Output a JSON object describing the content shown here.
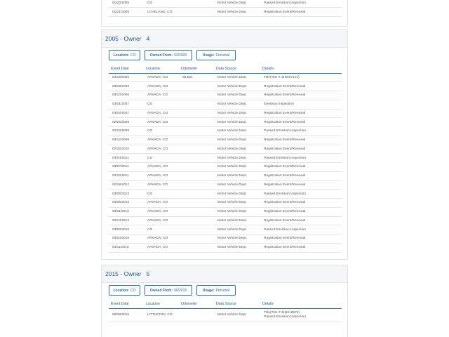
{
  "top_section": {
    "rows": [
      [
        "01/20/2005",
        "CO",
        "",
        "Motor Vehicle Dept.",
        "Passed Emission Inspection"
      ],
      [
        "01/21/2005",
        "LOVELAND, CO",
        "",
        "Motor Vehicle Dept.",
        "Registration Event/Renewal"
      ]
    ]
  },
  "columns": [
    "Event Date",
    "Location",
    "Odometer",
    "Data Source",
    "Details"
  ],
  "owners": [
    {
      "year": "2005",
      "title_sep": " - Owner   ",
      "number": "4",
      "location_label": "Location:",
      "location": "CO",
      "owned_from_label": "Owned From:",
      "owned_from": "03/2005",
      "usage_label": "Usage:",
      "usage": "Personal",
      "rows": [
        [
          "03/18/2005",
          "ARVADA, CO",
          "58,551",
          "Motor Vehicle Dept.",
          "Title(Title #:11R607101)"
        ],
        [
          "03/18/2005",
          "ARVADA, CO",
          "",
          "Motor Vehicle Dept.",
          "Registration Event/Renewal"
        ],
        [
          "03/10/2006",
          "ARVADA, CO",
          "",
          "Motor Vehicle Dept.",
          "Registration Event/Renewal"
        ],
        [
          "03/01/2007",
          "CO",
          "",
          "Motor Vehicle Dept.",
          "Emission Inspection"
        ],
        [
          "03/02/2007",
          "ARVADA, CO",
          "",
          "Motor Vehicle Dept.",
          "Registration Event/Renewal"
        ],
        [
          "02/25/2008",
          "ARVADA, CO",
          "",
          "Motor Vehicle Dept.",
          "Registration Event/Renewal"
        ],
        [
          "03/10/2009",
          "CO",
          "",
          "Motor Vehicle Dept.",
          "Passed Emission Inspection"
        ],
        [
          "03/12/2009",
          "ARVADA, CO",
          "",
          "Motor Vehicle Dept.",
          "Registration Event/Renewal"
        ],
        [
          "02/26/2010",
          "ARVADA, CO",
          "",
          "Motor Vehicle Dept.",
          "Registration Event/Renewal"
        ],
        [
          "03/04/2011",
          "CO",
          "",
          "Motor Vehicle Dept.",
          "Passed Emission Inspection"
        ],
        [
          "03/07/2011",
          "ARVADA, CO",
          "",
          "Motor Vehicle Dept.",
          "Registration Event/Renewal"
        ],
        [
          "03/10/2011",
          "ARVADA, CO",
          "",
          "Motor Vehicle Dept.",
          "Registration Event/Renewal"
        ],
        [
          "02/29/2012",
          "ARVADA, CO",
          "",
          "Motor Vehicle Dept.",
          "Registration Event/Renewal"
        ],
        [
          "03/05/2013",
          "CO",
          "",
          "Motor Vehicle Dept.",
          "Passed Emission Inspection"
        ],
        [
          "03/06/2013",
          "ARVADA, CO",
          "",
          "Motor Vehicle Dept.",
          "Registration Event/Renewal"
        ],
        [
          "03/11/2013",
          "ARVADA, CO",
          "",
          "Motor Vehicle Dept.",
          "Registration Event/Renewal"
        ],
        [
          "03/14/2014",
          "ARVADA, CO",
          "",
          "Motor Vehicle Dept.",
          "Registration Event/Renewal"
        ],
        [
          "03/03/2015",
          "CO",
          "",
          "Motor Vehicle Dept.",
          "Passed Emission Inspection"
        ],
        [
          "03/04/2015",
          "ARVADA, CO",
          "",
          "Motor Vehicle Dept.",
          "Registration Event/Renewal"
        ],
        [
          "03/11/2015",
          "ARVADA, CO",
          "",
          "Motor Vehicle Dept.",
          "Registration Event/Renewal"
        ]
      ]
    },
    {
      "year": "2015",
      "title_sep": " - Owner   ",
      "number": "5",
      "location_label": "Location:",
      "location": "CO",
      "owned_from_label": "Owned From:",
      "owned_from": "06/2015",
      "usage_label": "Usage:",
      "usage": "Personal",
      "rows": [
        [
          "06/09/2015",
          "LITTLETON, CO",
          "",
          "Motor Vehicle Dept.",
          "Title(Title #:11Q616578)",
          "Passed Emission Inspection"
        ]
      ]
    }
  ],
  "colors": {
    "accent": "#2a6fb0",
    "title": "#1f5c99",
    "header_bg": "#f4f6f8",
    "border": "#dfe3e8"
  }
}
